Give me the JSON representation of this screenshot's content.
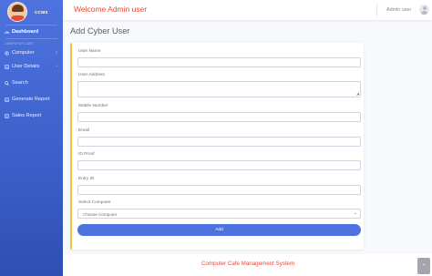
{
  "sidebar": {
    "brand_text": "CCMS",
    "heading": "COMPUTER CAFE",
    "items": [
      {
        "label": "Dashboard",
        "icon": "dashboard-icon"
      },
      {
        "label": "Computer",
        "icon": "computer-icon"
      },
      {
        "label": "User Details",
        "icon": "user-icon"
      },
      {
        "label": "Search",
        "icon": "search-icon"
      },
      {
        "label": "Generate Report",
        "icon": "report-icon"
      },
      {
        "label": "Sales Report",
        "icon": "sales-report-icon"
      }
    ]
  },
  "topbar": {
    "welcome": "Welcome  Admin user",
    "user_name": "Admin user"
  },
  "page_title": "Add Cyber User",
  "form": {
    "user_name_label": "User Name",
    "user_address_label": "User Address",
    "mobile_label": "Mobile Number",
    "email_label": "Email",
    "id_proof_label": "ID Proof",
    "entry_id_label": "Entry ID",
    "select_computer_label": "Select Computer",
    "select_computer_value": "Choose Computer",
    "add_button": "Add"
  },
  "footer": {
    "text": "Computer Cafe Management System"
  },
  "colors": {
    "sidebar": "#4e73df",
    "accent_red": "#e74a3b",
    "card_border": "#f6c23e",
    "button": "#4e73df"
  }
}
